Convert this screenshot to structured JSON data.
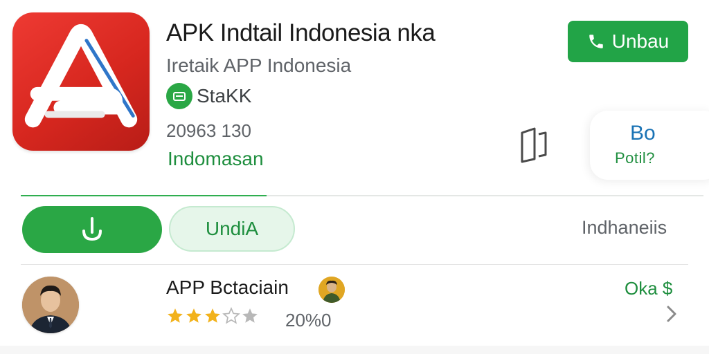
{
  "app": {
    "title": "APK Indtail Indonesia nka",
    "subtitle": "Iretaik APP Indonesia",
    "developer": "StaKK",
    "downloads": "20963 130",
    "region": "Indomasan",
    "icon_name": "app-logo-icon",
    "icon_color": "#d7271f"
  },
  "actions": {
    "call_label": "Unbau",
    "call_icon": "phone-icon",
    "bookmark_icon": "book-icon",
    "card_top": "Bo",
    "card_bottom": "Potil?",
    "download_icon": "download-arrow-icon",
    "secondary_label": "UndiA",
    "language_label": "Indhaneiis",
    "progress_fraction": 0.36
  },
  "review": {
    "title": "APP Bctaciain",
    "rating_stars": 3,
    "rating_max": 5,
    "rating_text": "20%0",
    "status": "Oka $",
    "chevron_icon": "chevron-right-icon"
  },
  "colors": {
    "accent_green": "#22a447",
    "brand_red": "#d7271f",
    "star_gold": "#f2b21b",
    "star_gray": "#b8b8b8"
  }
}
